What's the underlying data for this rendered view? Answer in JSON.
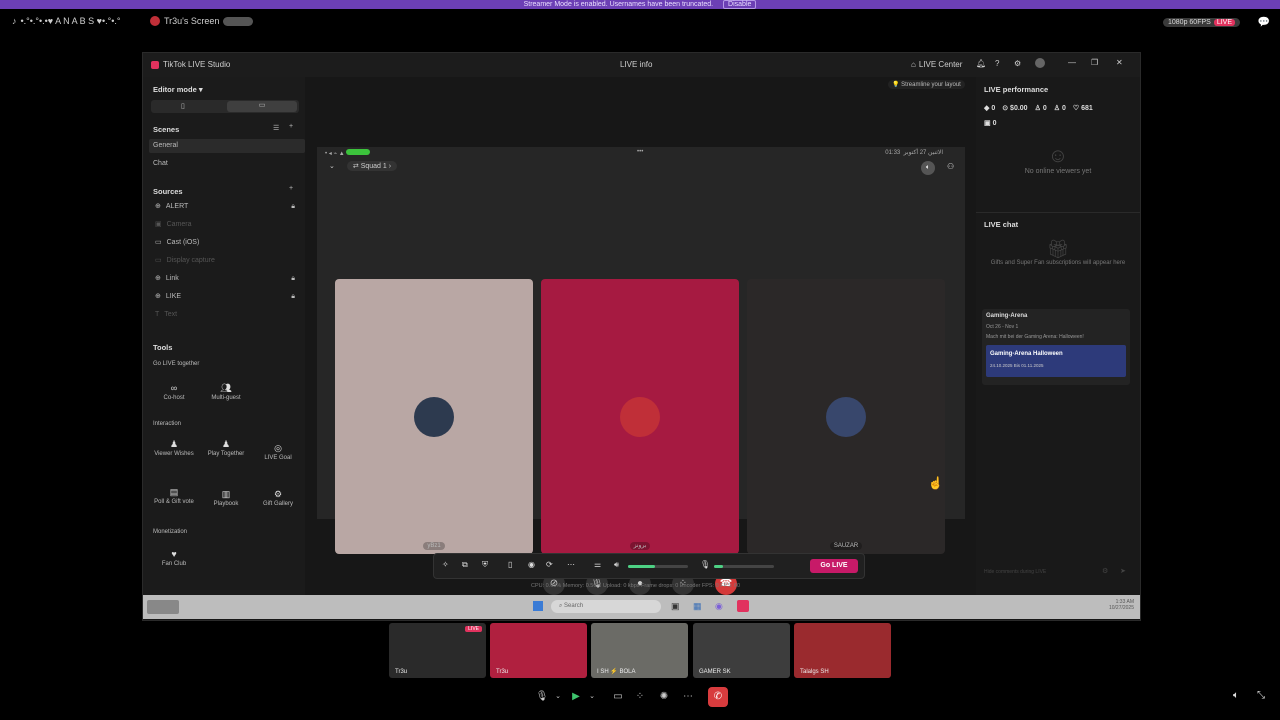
{
  "banner": {
    "text": "Streamer Mode is enabled. Usernames have been truncated.",
    "button": "Disable"
  },
  "topbar": {
    "server": "•.°•.°•.•♥ A N A B S ♥•.°•.°",
    "screen_label": "Tr3u's Screen",
    "quality": "1080p 60FPS",
    "live": "LIVE"
  },
  "app": {
    "title": "TikTok LIVE Studio",
    "center": "LIVE info",
    "live_center": "LIVE Center",
    "streamline": "Streamline your layout"
  },
  "left": {
    "editor_mode": "Editor mode",
    "scenes_header": "Scenes",
    "scenes": [
      "General",
      "Chat"
    ],
    "sources_header": "Sources",
    "sources": [
      {
        "name": "ALERT",
        "enabled": true
      },
      {
        "name": "Camera",
        "enabled": false
      },
      {
        "name": "Cast (iOS)",
        "enabled": true
      },
      {
        "name": "Display capture",
        "enabled": false
      },
      {
        "name": "Link",
        "enabled": true
      },
      {
        "name": "LIKE",
        "enabled": true
      },
      {
        "name": "Text",
        "enabled": false
      }
    ],
    "tools_header": "Tools",
    "go_live_together": "Go LIVE together",
    "cohost": "Co-host",
    "multiguest": "Multi-guest",
    "interaction": "Interaction",
    "viewer_wishes": "Viewer Wishes",
    "play_together": "Play Together",
    "live_goal": "LIVE Goal",
    "poll": "Poll & Gift vote",
    "playbook": "Playbook",
    "gift_gallery": "Gift Gallery",
    "monetization": "Monetization",
    "fan_club": "Fan Club"
  },
  "stage": {
    "phone_left": "Squad 1",
    "phone_date": "الاثنين 27 أكتوبر",
    "phone_time": "01:33",
    "tiles": [
      {
        "name": "yBz1",
        "bg": "#b9a7a4",
        "avatar": "#2d3a4f"
      },
      {
        "name": "برونز",
        "bg": "#a61a41",
        "avatar": "#c02f38"
      },
      {
        "name": "SAUZAR",
        "bg": "#2b2828",
        "avatar": "#38476c"
      }
    ]
  },
  "bottombar": {
    "go_live": "Go LIVE"
  },
  "stats": "CPU: 0.65%   Memory: 0.56%   Upload: 0 kbps   Frame drops: 0   Encoder FPS: 0   FPS: 60",
  "right": {
    "perf_header": "LIVE performance",
    "stats": [
      "0",
      "$0.00",
      "0",
      "0",
      "681",
      "0"
    ],
    "no_viewers": "No online viewers yet",
    "chat_header": "LIVE chat",
    "chat_empty": "Gifts and Super Fan subscriptions will appear here",
    "event_title": "Gaming-Arena",
    "event_dates": "Oct 26 - Nov 1",
    "event_desc": "Mach mit bei der Gaming Arena: Halloween!",
    "banner_title": "Gaming-Arena Halloween",
    "banner_sub": "24.10.2025 Bis 01.11.2025",
    "chat_placeholder": "Hide comments during LIVE"
  },
  "taskbar": {
    "search": "Search",
    "time": "1:33 AM",
    "date": "10/27/2025"
  },
  "thumbs": [
    {
      "label": "Tr3u",
      "live": "LIVE",
      "bg": "#2a2a2a"
    },
    {
      "label": "Tr3u",
      "bg": "#b0203f"
    },
    {
      "label": "I SH ⚡ BOLA",
      "bg": "#6b6b66"
    },
    {
      "label": "GAMER SK",
      "bg": "#3d3d3d"
    },
    {
      "label": "Talalgs SH",
      "bg": "#9a2a2e"
    }
  ]
}
